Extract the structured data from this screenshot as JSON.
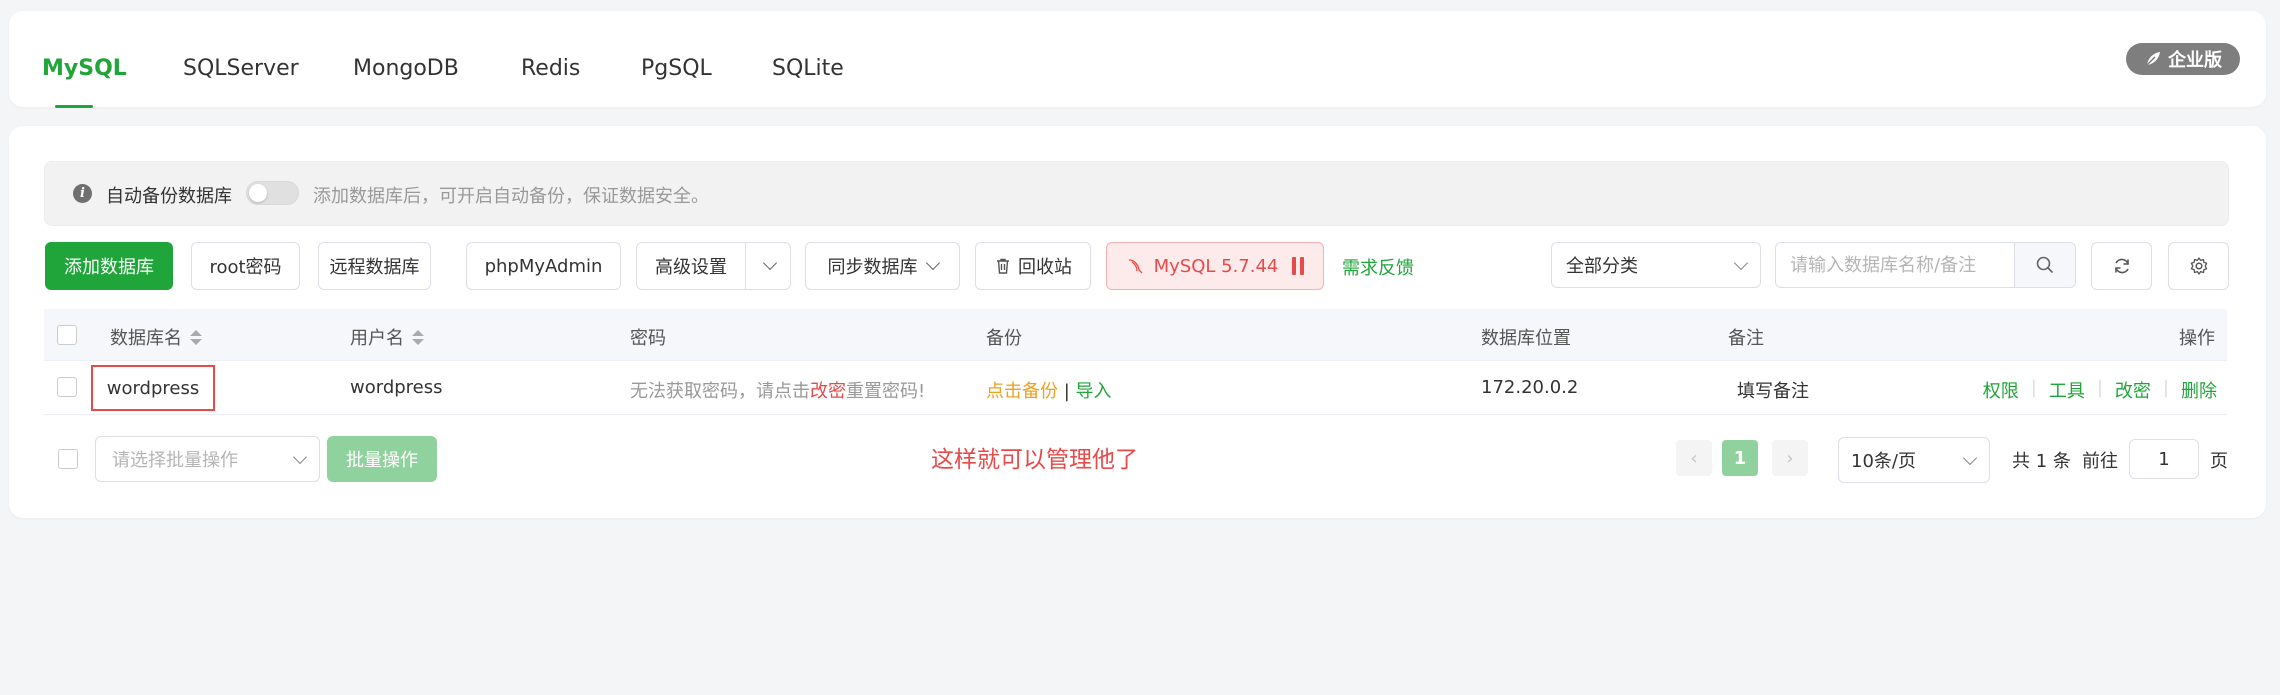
{
  "tabs": [
    {
      "label": "MySQL",
      "active": true
    },
    {
      "label": "SQLServer"
    },
    {
      "label": "MongoDB"
    },
    {
      "label": "Redis"
    },
    {
      "label": "PgSQL"
    },
    {
      "label": "SQLite"
    }
  ],
  "enterprise_badge": "企业版",
  "notice": {
    "label": "自动备份数据库",
    "hint": "添加数据库后，可开启自动备份，保证数据安全。"
  },
  "toolbar": {
    "add_db": "添加数据库",
    "root_password": "root密码",
    "remote_db": "远程数据库",
    "phpmyadmin": "phpMyAdmin",
    "advanced": "高级设置",
    "sync_db": "同步数据库",
    "recycle_bin": "回收站",
    "mysql_version": "MySQL 5.7.44",
    "feedback": "需求反馈",
    "category": "全部分类",
    "search_placeholder": "请输入数据库名称/备注"
  },
  "table": {
    "headers": {
      "name": "数据库名",
      "user": "用户名",
      "password": "密码",
      "backup": "备份",
      "location": "数据库位置",
      "note": "备注",
      "ops": "操作"
    },
    "rows": [
      {
        "name": "wordpress",
        "user": "wordpress",
        "password_prefix": "无法获取密码，请点击",
        "password_link": "改密",
        "password_suffix": "重置密码!",
        "backup_link": "点击备份",
        "backup_sep": "|",
        "import_link": "导入",
        "location": "172.20.0.2",
        "note": "填写备注",
        "ops": [
          "权限",
          "工具",
          "改密",
          "删除"
        ]
      }
    ]
  },
  "footer": {
    "batch_placeholder": "请选择批量操作",
    "batch_button": "批量操作",
    "annotation": "这样就可以管理他了",
    "current_page": "1",
    "page_size": "10条/页",
    "total": "共 1 条",
    "goto": "前往",
    "goto_value": "1",
    "page_unit": "页"
  },
  "colors": {
    "accent": "#20a53a",
    "danger": "#e84a4a",
    "warning": "#f0a020"
  }
}
